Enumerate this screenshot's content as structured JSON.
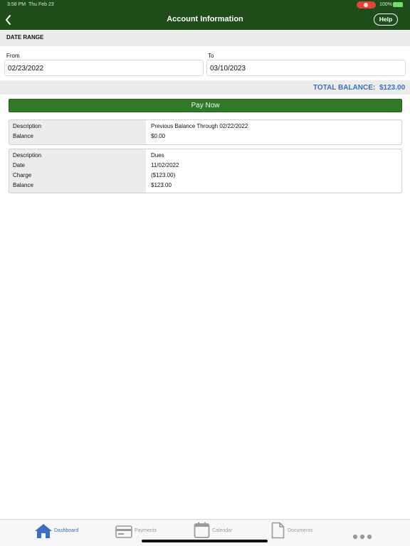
{
  "status_bar": {
    "time": "3:58 PM",
    "date": "Thu Feb 23",
    "battery": "100%"
  },
  "nav": {
    "title": "Account Information",
    "help_label": "Help"
  },
  "date_range": {
    "header": "DATE RANGE",
    "from_label": "From",
    "from_value": "02/23/2022",
    "to_label": "To",
    "to_value": "03/10/2023"
  },
  "total": {
    "label": "TOTAL BALANCE:",
    "value": "$123.00"
  },
  "pay_now_label": "Pay Now",
  "transactions": [
    {
      "rows": [
        {
          "key": "Description",
          "value": "Previous Balance Through 02/22/2022"
        },
        {
          "key": "Balance",
          "value": "$0.00"
        }
      ]
    },
    {
      "rows": [
        {
          "key": "Description",
          "value": "Dues"
        },
        {
          "key": "Date",
          "value": "11/02/2022"
        },
        {
          "key": "Charge",
          "value": "($123.00)"
        },
        {
          "key": "Balance",
          "value": "$123.00"
        }
      ]
    }
  ],
  "tabs": [
    {
      "label": "Dashboard",
      "icon": "home-icon",
      "active": true
    },
    {
      "label": "Payments",
      "icon": "credit-card-icon",
      "active": false
    },
    {
      "label": "Calendar",
      "icon": "calendar-icon",
      "active": false
    },
    {
      "label": "Documents",
      "icon": "document-icon",
      "active": false
    },
    {
      "label": "",
      "icon": "more-icon",
      "active": false
    }
  ],
  "colors": {
    "header_green": "#1f4d1a",
    "button_green": "#2e7a26",
    "accent_blue": "#3a6fc4",
    "inactive_gray": "#9a9a9a"
  }
}
